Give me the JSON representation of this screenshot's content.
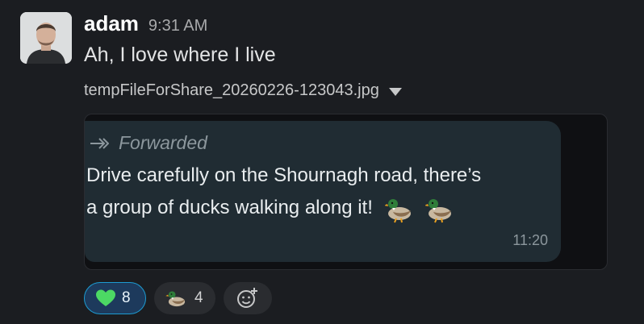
{
  "message": {
    "author": "adam",
    "time": "9:31 AM",
    "text": "Ah, I love where I live",
    "avatar_icon": "profile-photo"
  },
  "attachment": {
    "file_name": "tempFileForShare_20260226-123043.jpg",
    "forwarded_label": "Forwarded",
    "body_line1": "Drive carefully on the Shournagh road, there’s",
    "body_line2": "a group of ducks walking along it!",
    "emoji_icons": [
      "duck-icon",
      "duck-icon"
    ],
    "time": "11:20"
  },
  "reactions": [
    {
      "icon": "green-heart-icon",
      "count": "8",
      "active": true,
      "color": "#1d9bd1"
    },
    {
      "icon": "duck-icon",
      "count": "4",
      "active": false
    }
  ],
  "add_reaction_icon": "add-reaction-icon",
  "colors": {
    "background": "#1b1d21",
    "bubble": "#202c33",
    "accent": "#1d9bd1"
  }
}
